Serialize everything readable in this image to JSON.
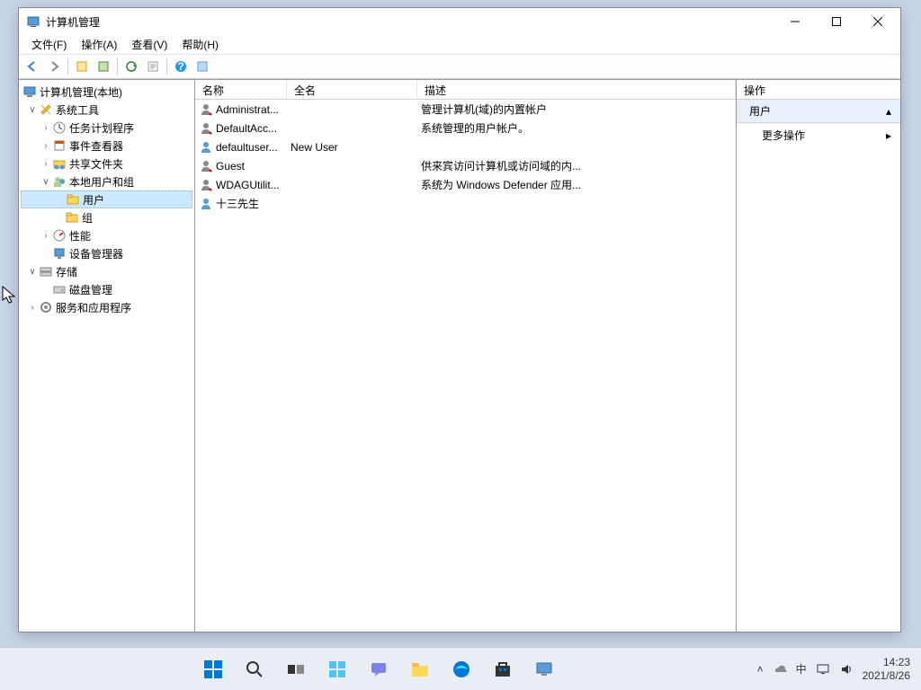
{
  "window": {
    "title": "计算机管理"
  },
  "menu": {
    "file": "文件(F)",
    "action": "操作(A)",
    "view": "查看(V)",
    "help": "帮助(H)"
  },
  "tree": {
    "root": "计算机管理(本地)",
    "system_tools": "系统工具",
    "task_scheduler": "任务计划程序",
    "event_viewer": "事件查看器",
    "shared_folders": "共享文件夹",
    "local_users_groups": "本地用户和组",
    "users": "用户",
    "groups": "组",
    "performance": "性能",
    "device_manager": "设备管理器",
    "storage": "存储",
    "disk_management": "磁盘管理",
    "services_apps": "服务和应用程序"
  },
  "columns": {
    "name": "名称",
    "fullname": "全名",
    "description": "描述"
  },
  "users": [
    {
      "name": "Administrat...",
      "fullname": "",
      "desc": "管理计算机(域)的内置帐户"
    },
    {
      "name": "DefaultAcc...",
      "fullname": "",
      "desc": "系统管理的用户帐户。"
    },
    {
      "name": "defaultuser...",
      "fullname": "New User",
      "desc": ""
    },
    {
      "name": "Guest",
      "fullname": "",
      "desc": "供来宾访问计算机或访问域的内..."
    },
    {
      "name": "WDAGUtilit...",
      "fullname": "",
      "desc": "系统为 Windows Defender 应用..."
    },
    {
      "name": "十三先生",
      "fullname": "",
      "desc": ""
    }
  ],
  "actions": {
    "header": "操作",
    "section": "用户",
    "more": "更多操作"
  },
  "systray": {
    "ime": "中",
    "time": "14:23",
    "date": "2021/8/26"
  }
}
